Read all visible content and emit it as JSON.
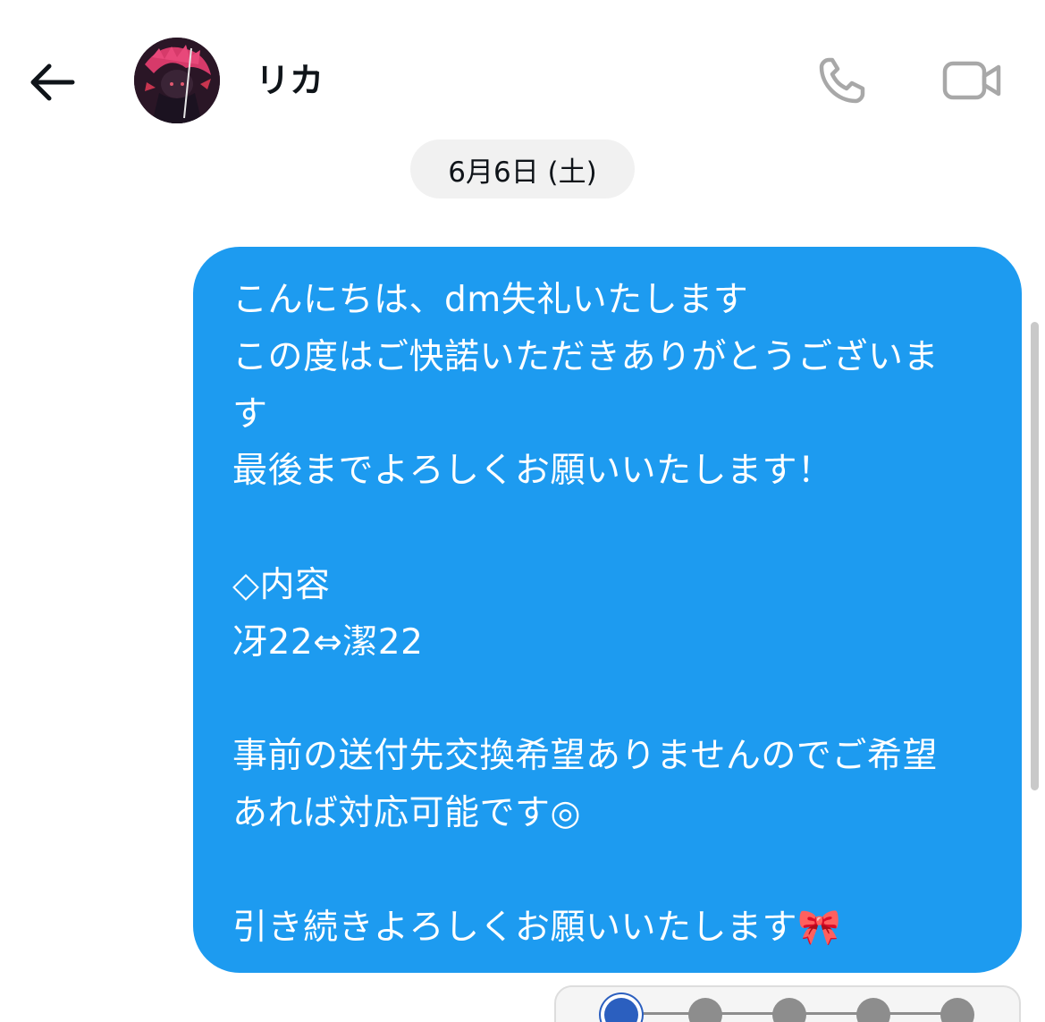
{
  "header": {
    "contact_name": "リカ",
    "back_icon": "arrow-left-icon",
    "call_icon": "phone-icon",
    "video_icon": "video-camera-icon",
    "icon_color": "#0f1419",
    "muted_icon_color": "#a8a8a8"
  },
  "conversation": {
    "date_label": "6月6日 (土)",
    "message": {
      "lines": [
        "こんにちは、dm失礼いたします",
        "この度はご快諾いただきありがとうございま",
        "す",
        "最後までよろしくお願いいたします！",
        "",
        "◇内容",
        "冴22⇔潔22",
        "",
        "事前の送付先交換希望ありませんのでご希望",
        "あれば対応可能です◎",
        "",
        "引き続きよろしくお願いいたします🎀"
      ],
      "bubble_color": "#1d9bf0",
      "text_color": "#ffffff"
    }
  },
  "stepper": {
    "total_steps": 5,
    "current_step": 1,
    "active_color": "#2b5fbf",
    "inactive_color": "#8d8d8d"
  }
}
